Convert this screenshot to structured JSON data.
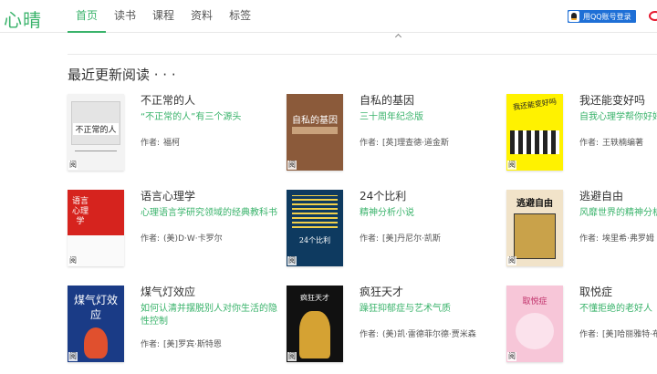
{
  "header": {
    "logo": "心晴",
    "nav": [
      {
        "label": "首页",
        "active": true
      },
      {
        "label": "读书",
        "active": false
      },
      {
        "label": "课程",
        "active": false
      },
      {
        "label": "资料",
        "active": false
      },
      {
        "label": "标签",
        "active": false
      }
    ],
    "qq_login": "用QQ账号登录"
  },
  "section": {
    "title": "最近更新阅读 · · ·"
  },
  "read_badge": "阅",
  "books": [
    {
      "title": "不正常的人",
      "desc": "“不正常的人”有三个源头",
      "author_label": "作者:",
      "author": "福柯",
      "cover_text": "不正常的人"
    },
    {
      "title": "自私的基因",
      "desc": "三十周年纪念版",
      "author_label": "作者:",
      "author": "[英]理查德·道金斯",
      "cover_text": "自私的基因"
    },
    {
      "title": "我还能变好吗",
      "desc": "自我心理学帮你好好做自己",
      "author_label": "作者:",
      "author": "王轶楠编著",
      "cover_text": "我还能变好吗"
    },
    {
      "title": "语言心理学",
      "desc": "心理语言学研究领域的经典教科书",
      "author_label": "作者:",
      "author": "(美)D·W·卡罗尔",
      "cover_text": "语言心理学"
    },
    {
      "title": "24个比利",
      "desc": "精神分析小说",
      "author_label": "作者:",
      "author": "[美]丹尼尔·凯斯",
      "cover_text": "24个比利"
    },
    {
      "title": "逃避自由",
      "desc": "风靡世界的精神分析学经典",
      "author_label": "作者:",
      "author": "埃里希·弗罗姆",
      "cover_text": "逃避自由"
    },
    {
      "title": "煤气灯效应",
      "desc": "如何认清并摆脱别人对你生活的隐性控制",
      "author_label": "作者:",
      "author": "[美]罗宾·斯特恩",
      "cover_text": "煤气灯效应"
    },
    {
      "title": "疯狂天才",
      "desc": "躁狂抑郁症与艺术气质",
      "author_label": "作者:",
      "author": "(美)凯·雷德菲尔德·贾米森",
      "cover_text": "疯狂天才"
    },
    {
      "title": "取悦症",
      "desc": "不懂拒绝的老好人",
      "author_label": "作者:",
      "author": "[美]哈丽雅特·布莱克",
      "cover_text": "取悦症"
    }
  ],
  "colors": {
    "accent": "#3ab36b",
    "qq_blue": "#1e6fd6",
    "weibo_red": "#e6162d"
  }
}
